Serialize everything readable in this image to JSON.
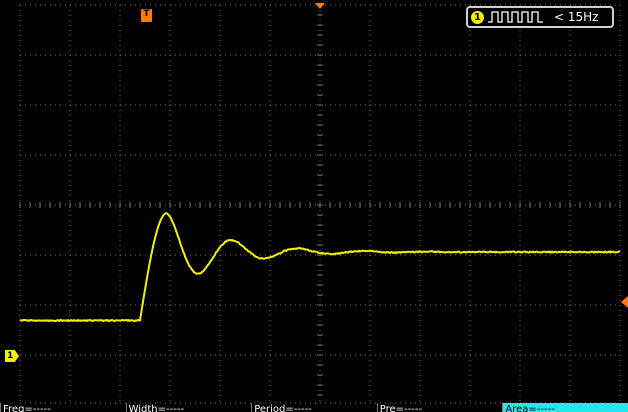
{
  "scope": {
    "trigger": {
      "channel": "1",
      "icon": "pulse-train-icon",
      "condition": "< 15Hz"
    },
    "markers": {
      "trigger_position": "T",
      "ch1_ground": "1"
    },
    "colors": {
      "background": "#000000",
      "grid": "#6f6f6f",
      "ch1_trace": "#f4f000",
      "trigger_marker": "#ff7a00",
      "active_measure": "#27e6f0"
    },
    "measurements": [
      {
        "label": "Freq=-----",
        "active": false
      },
      {
        "label": "Width=-----",
        "active": false
      },
      {
        "label": "Period=-----",
        "active": false
      },
      {
        "label": "Pre=-----",
        "active": false
      },
      {
        "label": "Area=-----",
        "active": true
      }
    ]
  }
}
